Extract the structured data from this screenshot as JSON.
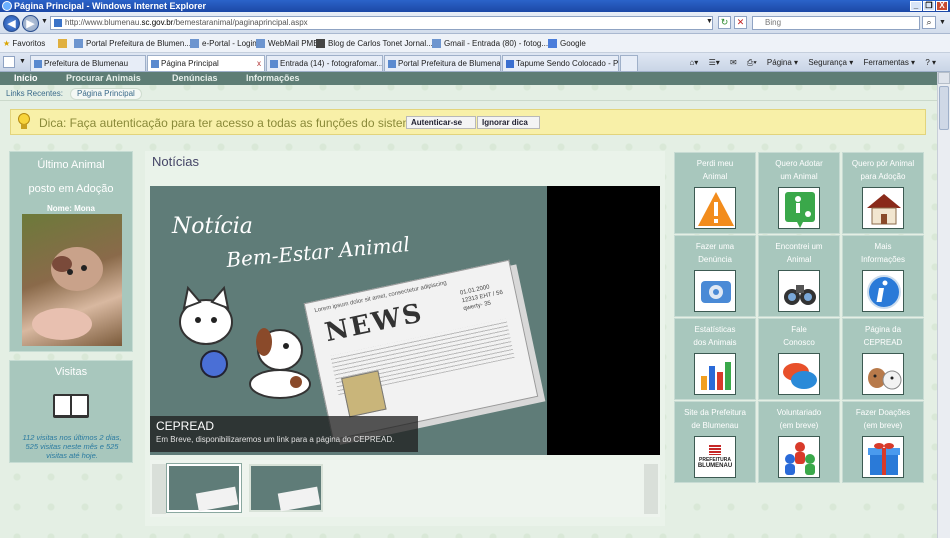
{
  "window": {
    "title": "Página Principal - Windows Internet Explorer",
    "controls": [
      "_",
      "❐",
      "X"
    ]
  },
  "address": {
    "url_prefix": "http://www.blumenau.",
    "url_domain": "sc.gov.br",
    "url_path": "/bemestaranimal/paginaprincipal.aspx",
    "search_placeholder": "Bing"
  },
  "favorites": {
    "label": "Favoritos",
    "items": [
      "Portal Prefeitura de Blumen...",
      "e-Portal - Login",
      "WebMail PMB",
      "Blog de Carlos Tonet  Jornal...",
      "Gmail - Entrada (80) - fotog...",
      "Google"
    ]
  },
  "tabs": [
    "Prefeitura de Blumenau",
    "Página Principal",
    "Entrada (14) - fotografomar...",
    "Portal Prefeitura de Blumena...",
    "Tapume Sendo Colocado - P..."
  ],
  "commands": [
    "Página ▾",
    "Segurança ▾",
    "Ferramentas ▾",
    "? ▾"
  ],
  "menu": [
    "Início",
    "Procurar Animais",
    "Denúncias",
    "Informações"
  ],
  "recent": {
    "label": "Links Recentes:",
    "current": "Página Principal"
  },
  "tip": {
    "text": "Dica: Faça autenticação para ter acesso a todas as funções do sistema:",
    "login": "Autenticar-se",
    "ignore": "Ignorar dica"
  },
  "last_animal": {
    "title1": "Último Animal",
    "title2": "posto em Adoção",
    "name": "Nome: Mona"
  },
  "visits": {
    "title": "Visitas",
    "text1": "112 visitas nos últimos 2 dias,",
    "text2": "525 visitas neste mês e 525",
    "text3": "visitas até hoje."
  },
  "news": {
    "heading": "Notícias",
    "banner1": "Notícia",
    "banner2": "Bem-Estar Animal",
    "paper_lines": "Lorem ipsum dolor sit amet, consectetur adipiscing",
    "paper_date": "01.01.2000",
    "paper_num": "12313 EHT / 56",
    "paper_qw": "qwerty- 35",
    "paper_word": "NEWS",
    "caption_title": "CEPREAD",
    "caption_text": "Em Breve, disponibilizaremos um link para a página do CEPREAD."
  },
  "tiles": [
    {
      "l1": "Perdi meu",
      "l2": "Animal",
      "icon": "warning-icon"
    },
    {
      "l1": "Quero Adotar",
      "l2": "um Animal",
      "icon": "walk-icon"
    },
    {
      "l1": "Quero pôr Animal",
      "l2": "para Adoção",
      "icon": "house-icon"
    },
    {
      "l1": "Fazer uma",
      "l2": "Denúncia",
      "icon": "phone-icon"
    },
    {
      "l1": "Encontrei um",
      "l2": "Animal",
      "icon": "binoculars-icon"
    },
    {
      "l1": "Mais",
      "l2": "Informações",
      "icon": "info-icon"
    },
    {
      "l1": "Estatísticas",
      "l2": "dos Animais",
      "icon": "chart-icon"
    },
    {
      "l1": "Fale",
      "l2": "Conosco",
      "icon": "chat-icon"
    },
    {
      "l1": "Página da",
      "l2": "CEPREAD",
      "icon": "pets-icon"
    },
    {
      "l1": "Site da Prefeitura",
      "l2": "de Blumenau",
      "icon": "prefeitura-logo-icon",
      "logo_text1": "PREFEITURA",
      "logo_text2": "BLUMENAU"
    },
    {
      "l1": "Voluntariado",
      "l2": "(em breve)",
      "icon": "people-icon"
    },
    {
      "l1": "Fazer Doações",
      "l2": "(em breve)",
      "icon": "gift-icon"
    }
  ]
}
